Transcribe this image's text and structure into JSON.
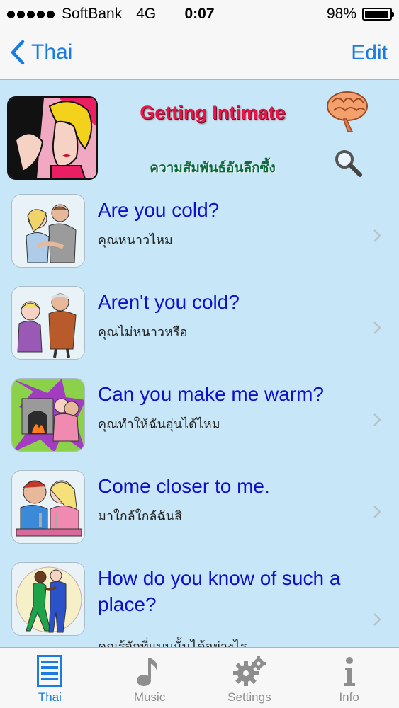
{
  "status": {
    "carrier": "SoftBank",
    "network": "4G",
    "time": "0:07",
    "battery": "98%",
    "battery_level": 0.98
  },
  "nav": {
    "back_label": "Thai",
    "edit_label": "Edit"
  },
  "header": {
    "title": "Getting Intimate",
    "subtitle": "ความสัมพันธ์อันลึกซึ้ง"
  },
  "phrases": [
    {
      "english": "Are you cold?",
      "thai": "คุณหนาวไหม",
      "icon": "couple-hug-image"
    },
    {
      "english": "Aren't you cold?",
      "thai": "คุณไม่หนาวหรือ",
      "icon": "elderly-couple-image"
    },
    {
      "english": "Can you make me warm?",
      "thai": "คุณทำให้ฉันอุ่นได้ไหม",
      "icon": "fireplace-couple-image"
    },
    {
      "english": "Come closer to me.",
      "thai": "มาใกล้ใกล้ฉันสิ",
      "icon": "cafe-couple-image"
    },
    {
      "english": "How do you know of such a place?",
      "thai": "คุณรู้จักที่แบบนั้นได้อย่างไร",
      "icon": "dancing-couple-image"
    }
  ],
  "tabs": [
    {
      "label": "Thai",
      "icon": "list-icon",
      "active": true
    },
    {
      "label": "Music",
      "icon": "music-note-icon",
      "active": false
    },
    {
      "label": "Settings",
      "icon": "gear-icon",
      "active": false
    },
    {
      "label": "Info",
      "icon": "info-icon",
      "active": false
    }
  ],
  "colors": {
    "accent": "#1a7ce0",
    "background": "#c7e6f7",
    "title": "#e8154a",
    "phrase": "#1010cc"
  }
}
